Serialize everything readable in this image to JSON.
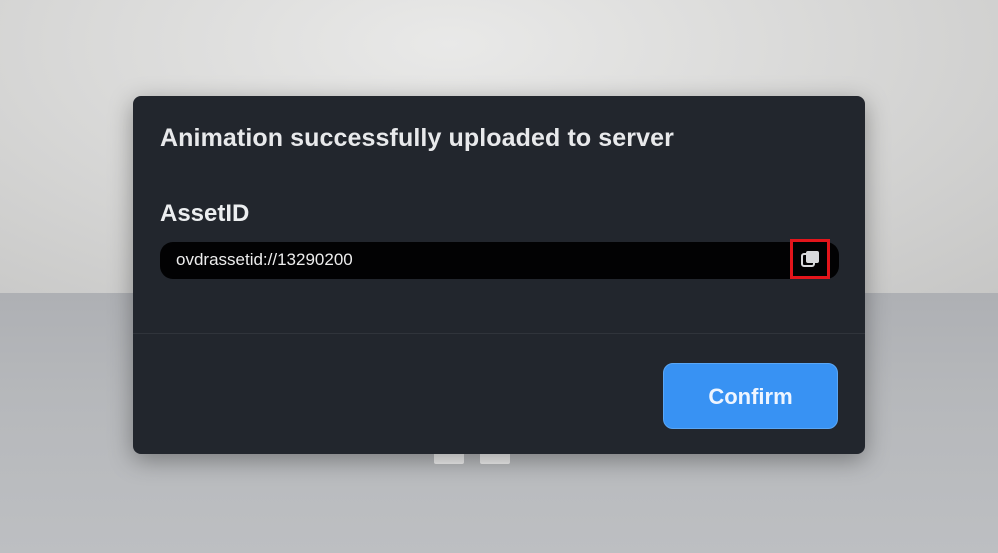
{
  "dialog": {
    "title": "Animation successfully uploaded to server",
    "field_label": "AssetID",
    "asset_id_value": "ovdrassetid://13290200",
    "copy_icon": "copy-icon",
    "confirm_label": "Confirm"
  },
  "colors": {
    "dialog_bg": "#22262d",
    "field_bg": "#020203",
    "accent": "#3892f3",
    "highlight": "#e3151b"
  }
}
